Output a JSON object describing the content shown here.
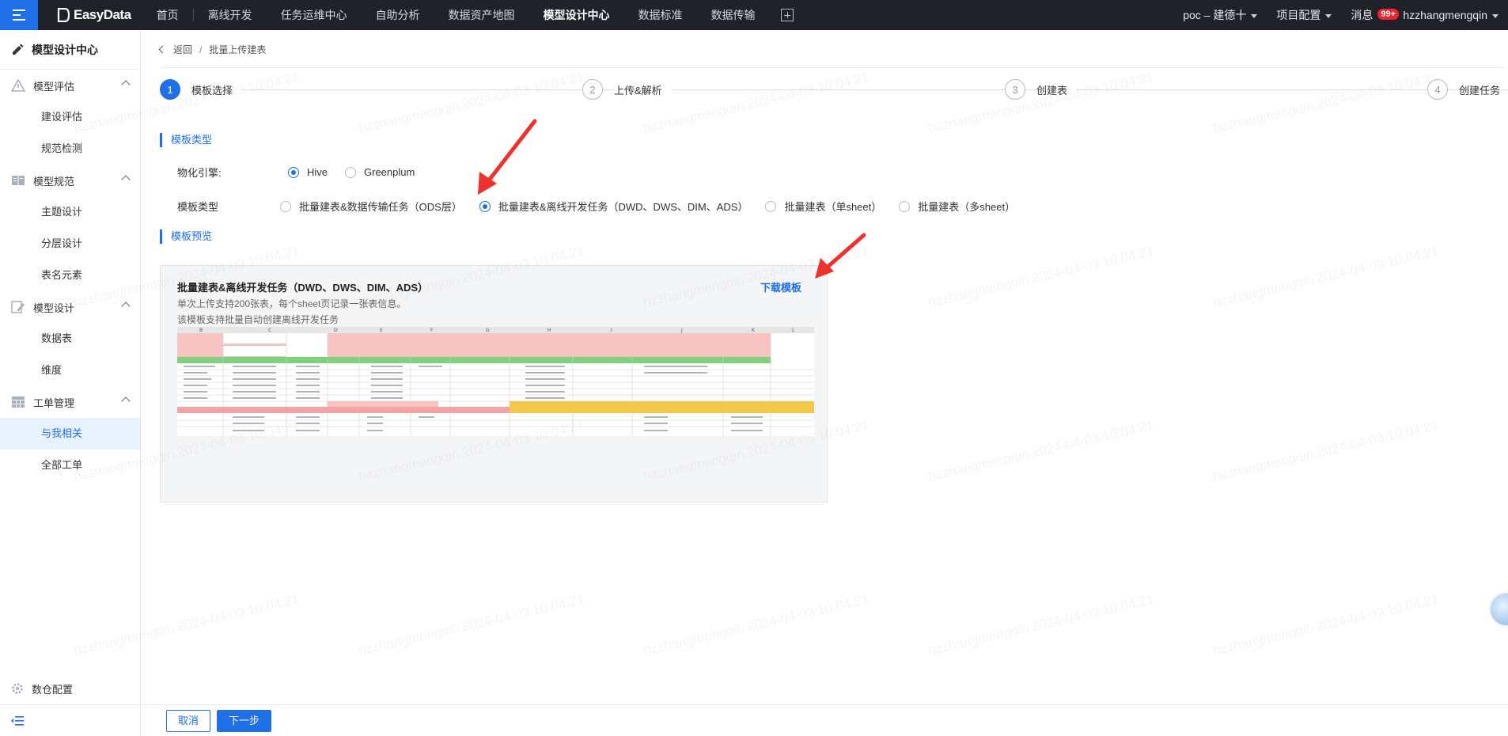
{
  "topnav": {
    "logo": "EasyData",
    "items": [
      "首页",
      "离线开发",
      "任务运维中心",
      "自助分析",
      "数据资产地图",
      "模型设计中心",
      "数据标准",
      "数据传输"
    ],
    "active_index": 5,
    "project": "poc – 建德十",
    "project_config": "项目配置",
    "messages": "消息",
    "messages_badge": "99+",
    "user": "hzzhangmengqin"
  },
  "sidebar": {
    "title": "模型设计中心",
    "groups": [
      {
        "label": "模型评估",
        "icon": "warning-triangle-icon",
        "items": [
          "建设评估",
          "规范检测"
        ]
      },
      {
        "label": "模型规范",
        "icon": "book-icon",
        "items": [
          "主题设计",
          "分层设计",
          "表名元素"
        ]
      },
      {
        "label": "模型设计",
        "icon": "edit-icon",
        "items": [
          "数据表",
          "维度"
        ]
      },
      {
        "label": "工单管理",
        "icon": "grid-icon",
        "items": [
          "与我相关",
          "全部工单"
        ]
      }
    ],
    "active_item": "与我相关",
    "bottom_config": "数仓配置"
  },
  "breadcrumb": {
    "back": "返回",
    "current": "批量上传建表"
  },
  "steps": [
    {
      "num": "1",
      "label": "模板选择"
    },
    {
      "num": "2",
      "label": "上传&解析"
    },
    {
      "num": "3",
      "label": "创建表"
    },
    {
      "num": "4",
      "label": "创建任务"
    }
  ],
  "section_template_type": "模板类型",
  "engine": {
    "label": "物化引擎:",
    "options": [
      "Hive",
      "Greenplum"
    ],
    "selected": "Hive"
  },
  "template_type": {
    "label": "模板类型",
    "options": [
      "批量建表&数据传输任务（ODS层）",
      "批量建表&离线开发任务（DWD、DWS、DIM、ADS）",
      "批量建表（单sheet）",
      "批量建表（多sheet）"
    ],
    "selected": "批量建表&离线开发任务（DWD、DWS、DIM、ADS）"
  },
  "section_preview": "模板预览",
  "preview": {
    "title": "批量建表&离线开发任务（DWD、DWS、DIM、ADS）",
    "download": "下载模板",
    "desc1": "单次上传支持200张表，每个sheet页记录一张表信息。",
    "desc2": "该模板支持批量自动创建离线开发任务",
    "sheet_columns": [
      "B",
      "C",
      "D",
      "E",
      "F",
      "G",
      "H",
      "I",
      "J",
      "K",
      "L"
    ]
  },
  "footer": {
    "cancel": "取消",
    "next": "下一步"
  },
  "watermark": "hzzhangmengqin 2024-04-03 10:04:21",
  "colors": {
    "primary": "#1f6fe6",
    "topnav_bg": "#1f2229",
    "active_bg": "#e8f1ff",
    "arrow": "#f0302a"
  }
}
